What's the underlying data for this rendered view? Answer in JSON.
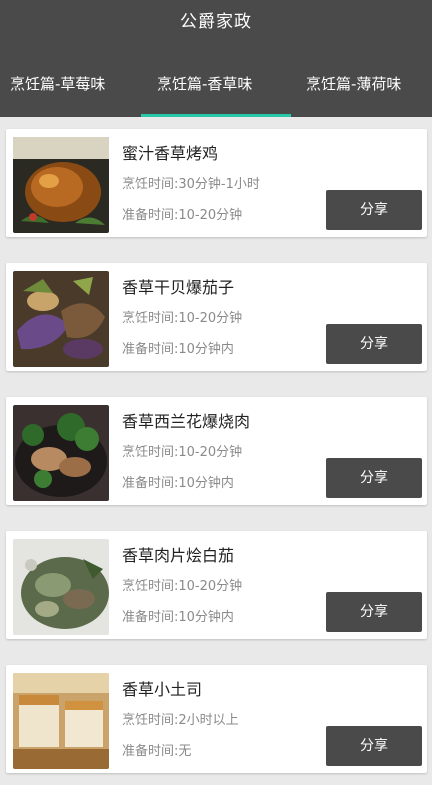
{
  "header": {
    "title": "公爵家政"
  },
  "tabs": [
    {
      "label": "烹饪篇-草莓味"
    },
    {
      "label": "烹饪篇-香草味",
      "active": true
    },
    {
      "label": "烹饪篇-薄荷味"
    }
  ],
  "colors": {
    "bar": "#4a4a4a",
    "accent": "#29c9a8"
  },
  "recipes": [
    {
      "name": "蜜汁香草烤鸡",
      "cook_time": "烹饪时间:30分钟-1小时",
      "prep_time": "准备时间:10-20分钟",
      "share_label": "分享"
    },
    {
      "name": "香草干贝爆茄子",
      "cook_time": "烹饪时间:10-20分钟",
      "prep_time": "准备时间:10分钟内",
      "share_label": "分享"
    },
    {
      "name": "香草西兰花爆烧肉",
      "cook_time": "烹饪时间:10-20分钟",
      "prep_time": "准备时间:10分钟内",
      "share_label": "分享"
    },
    {
      "name": "香草肉片烩白茄",
      "cook_time": "烹饪时间:10-20分钟",
      "prep_time": "准备时间:10分钟内",
      "share_label": "分享"
    },
    {
      "name": "香草小土司",
      "cook_time": "烹饪时间:2小时以上",
      "prep_time": "准备时间:无",
      "share_label": "分享"
    }
  ]
}
